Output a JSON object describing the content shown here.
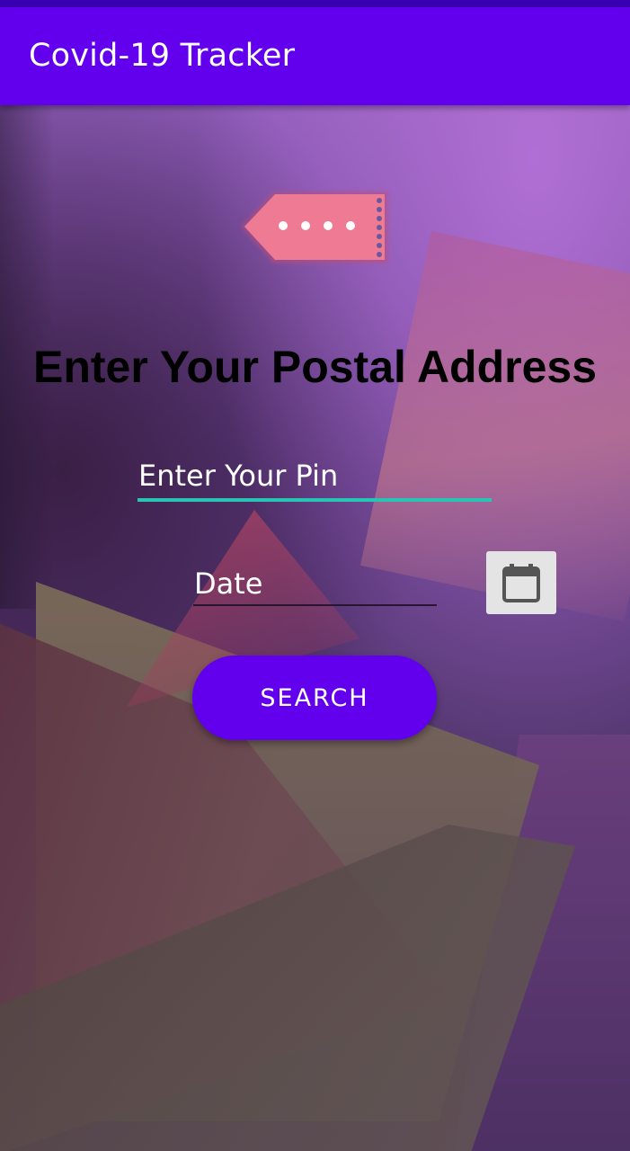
{
  "app_bar": {
    "title": "Covid-19 Tracker",
    "color": "#6200ee",
    "status_bar_color": "#3700b3"
  },
  "header_icon": "postal-tag-icon",
  "heading": "Enter Your Postal Address",
  "pin_input": {
    "value": "",
    "placeholder": "Enter Your Pin",
    "underline_color": "#26c6b4"
  },
  "date_input": {
    "value": "",
    "placeholder": "Date"
  },
  "calendar_button": {
    "icon": "calendar-icon"
  },
  "search_button": {
    "label": "SEARCH",
    "color": "#6200ee"
  }
}
